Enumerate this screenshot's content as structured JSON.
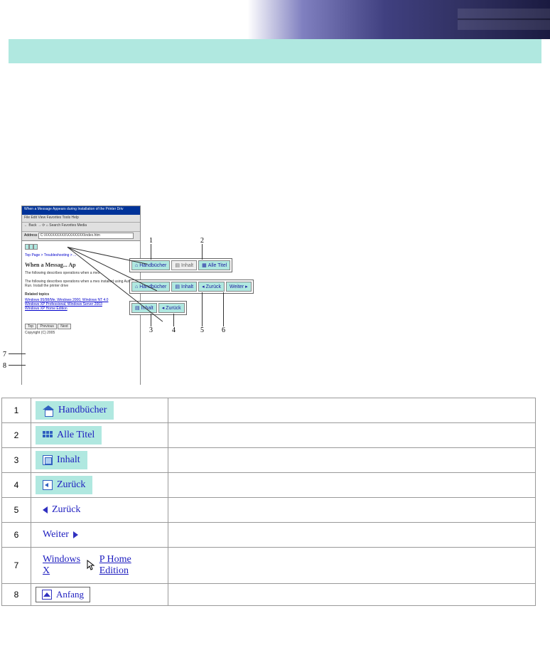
{
  "mockwin": {
    "title": "When a Message Appears during Installation of the Printer Driv",
    "menu": "File  Edit  View  Favorites  Tools  Help",
    "toolbar": "← Back  →   ⟳  ⌂  Search  Favorites  Media",
    "address_label": "Address",
    "address_value": "C:\\XXXXXXXXX\\XXXXXXX\\index.htm",
    "body": {
      "breadcrumb": "Top Page > Troubleshooting > ...",
      "heading": "When a Messag... Ap",
      "line1": "The following describes operations when a mes",
      "line2": "The following describes operations when a mes installed using Auto Run. Install the printer drive",
      "related": "Related topics",
      "link1": "Windows 95/98/Me, Windows 2000, Windows NT 4.0",
      "link2": "Windows XP Professional, Windows Server 2003",
      "link3": "Windows XP Home Edition",
      "copyright": "Copyright (C) 2005",
      "foot_top": "Top",
      "foot_prev": "Previous",
      "foot_next": "Next"
    }
  },
  "callouts": {
    "row1": {
      "manuals": "Handbücher",
      "contents_gray": "Inhalt",
      "all": "Alle Titel"
    },
    "row2": {
      "manuals": "Handbücher",
      "contents": "Inhalt",
      "back": "Zurück",
      "next": "Weiter"
    },
    "row3": {
      "contents": "Inhalt",
      "back": "Zurück"
    }
  },
  "numbers": {
    "n1": "1",
    "n2": "2",
    "n3": "3",
    "n4": "4",
    "n5": "5",
    "n6": "6",
    "n7": "7",
    "n8": "8"
  },
  "rows": [
    {
      "n": "1",
      "kind": "manuals",
      "label": "Handbücher",
      "desc": ""
    },
    {
      "n": "2",
      "kind": "all",
      "label": "Alle Titel",
      "desc": ""
    },
    {
      "n": "3",
      "kind": "contents",
      "label": "Inhalt",
      "desc": ""
    },
    {
      "n": "4",
      "kind": "backsq",
      "label": "Zurück",
      "desc": ""
    },
    {
      "n": "5",
      "kind": "prev",
      "label": "Zurück",
      "desc": ""
    },
    {
      "n": "6",
      "kind": "next",
      "label": "Weiter",
      "desc": ""
    },
    {
      "n": "7",
      "kind": "link",
      "label": "Windows XP Home Edition",
      "desc": ""
    },
    {
      "n": "8",
      "kind": "top",
      "label": "Anfang",
      "desc": ""
    }
  ]
}
